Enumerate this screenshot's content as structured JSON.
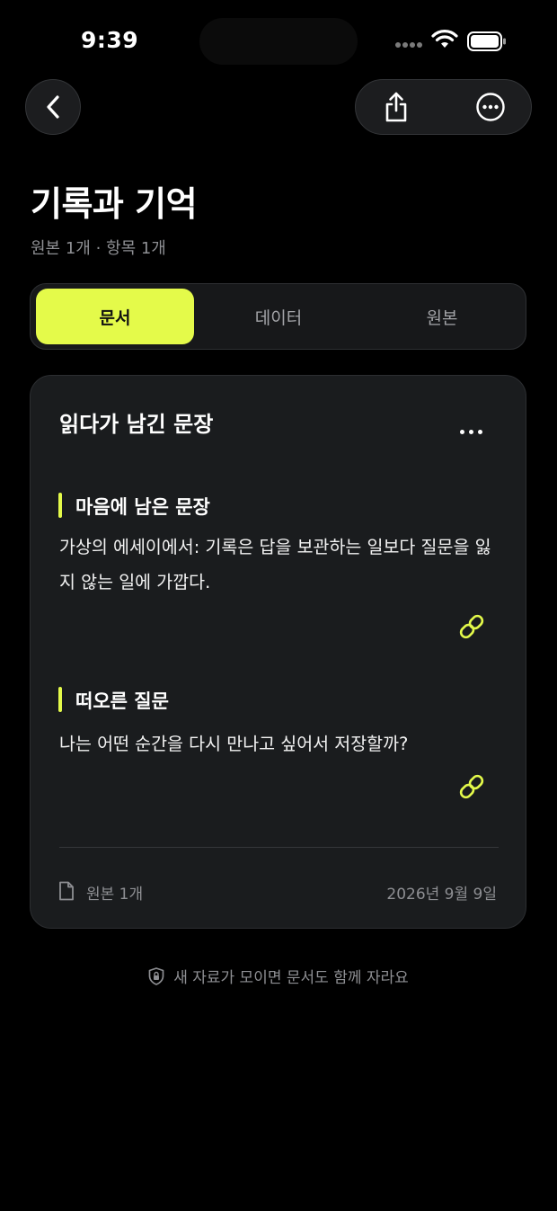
{
  "status_bar": {
    "time": "9:39"
  },
  "header": {
    "title": "기록과 기억",
    "subtitle": "원본 1개 · 항목 1개"
  },
  "tabs": [
    {
      "label": "문서",
      "active": true
    },
    {
      "label": "데이터",
      "active": false
    },
    {
      "label": "원본",
      "active": false
    }
  ],
  "card": {
    "title": "읽다가 남긴 문장",
    "sections": [
      {
        "heading": "마음에 남은 문장",
        "body": "가상의 에세이에서: 기록은 답을 보관하는 일보다 질문을 잃지 않는 일에 가깝다."
      },
      {
        "heading": "떠오른 질문",
        "body": "나는 어떤 순간을 다시 만나고 싶어서 저장할까?"
      }
    ],
    "footer": {
      "source_count": "원본 1개",
      "date": "2026년 9월 9일"
    }
  },
  "bottom_note": "새 자료가 모이면 문서도 함께 자라요",
  "colors": {
    "accent": "#e4fa4a",
    "background": "#000000",
    "card": "#1a1c1e",
    "muted_text": "#8e8f93"
  },
  "icons": [
    "back-chevron-icon",
    "share-icon",
    "more-icon",
    "link-icon",
    "document-icon",
    "lock-shield-icon"
  ]
}
